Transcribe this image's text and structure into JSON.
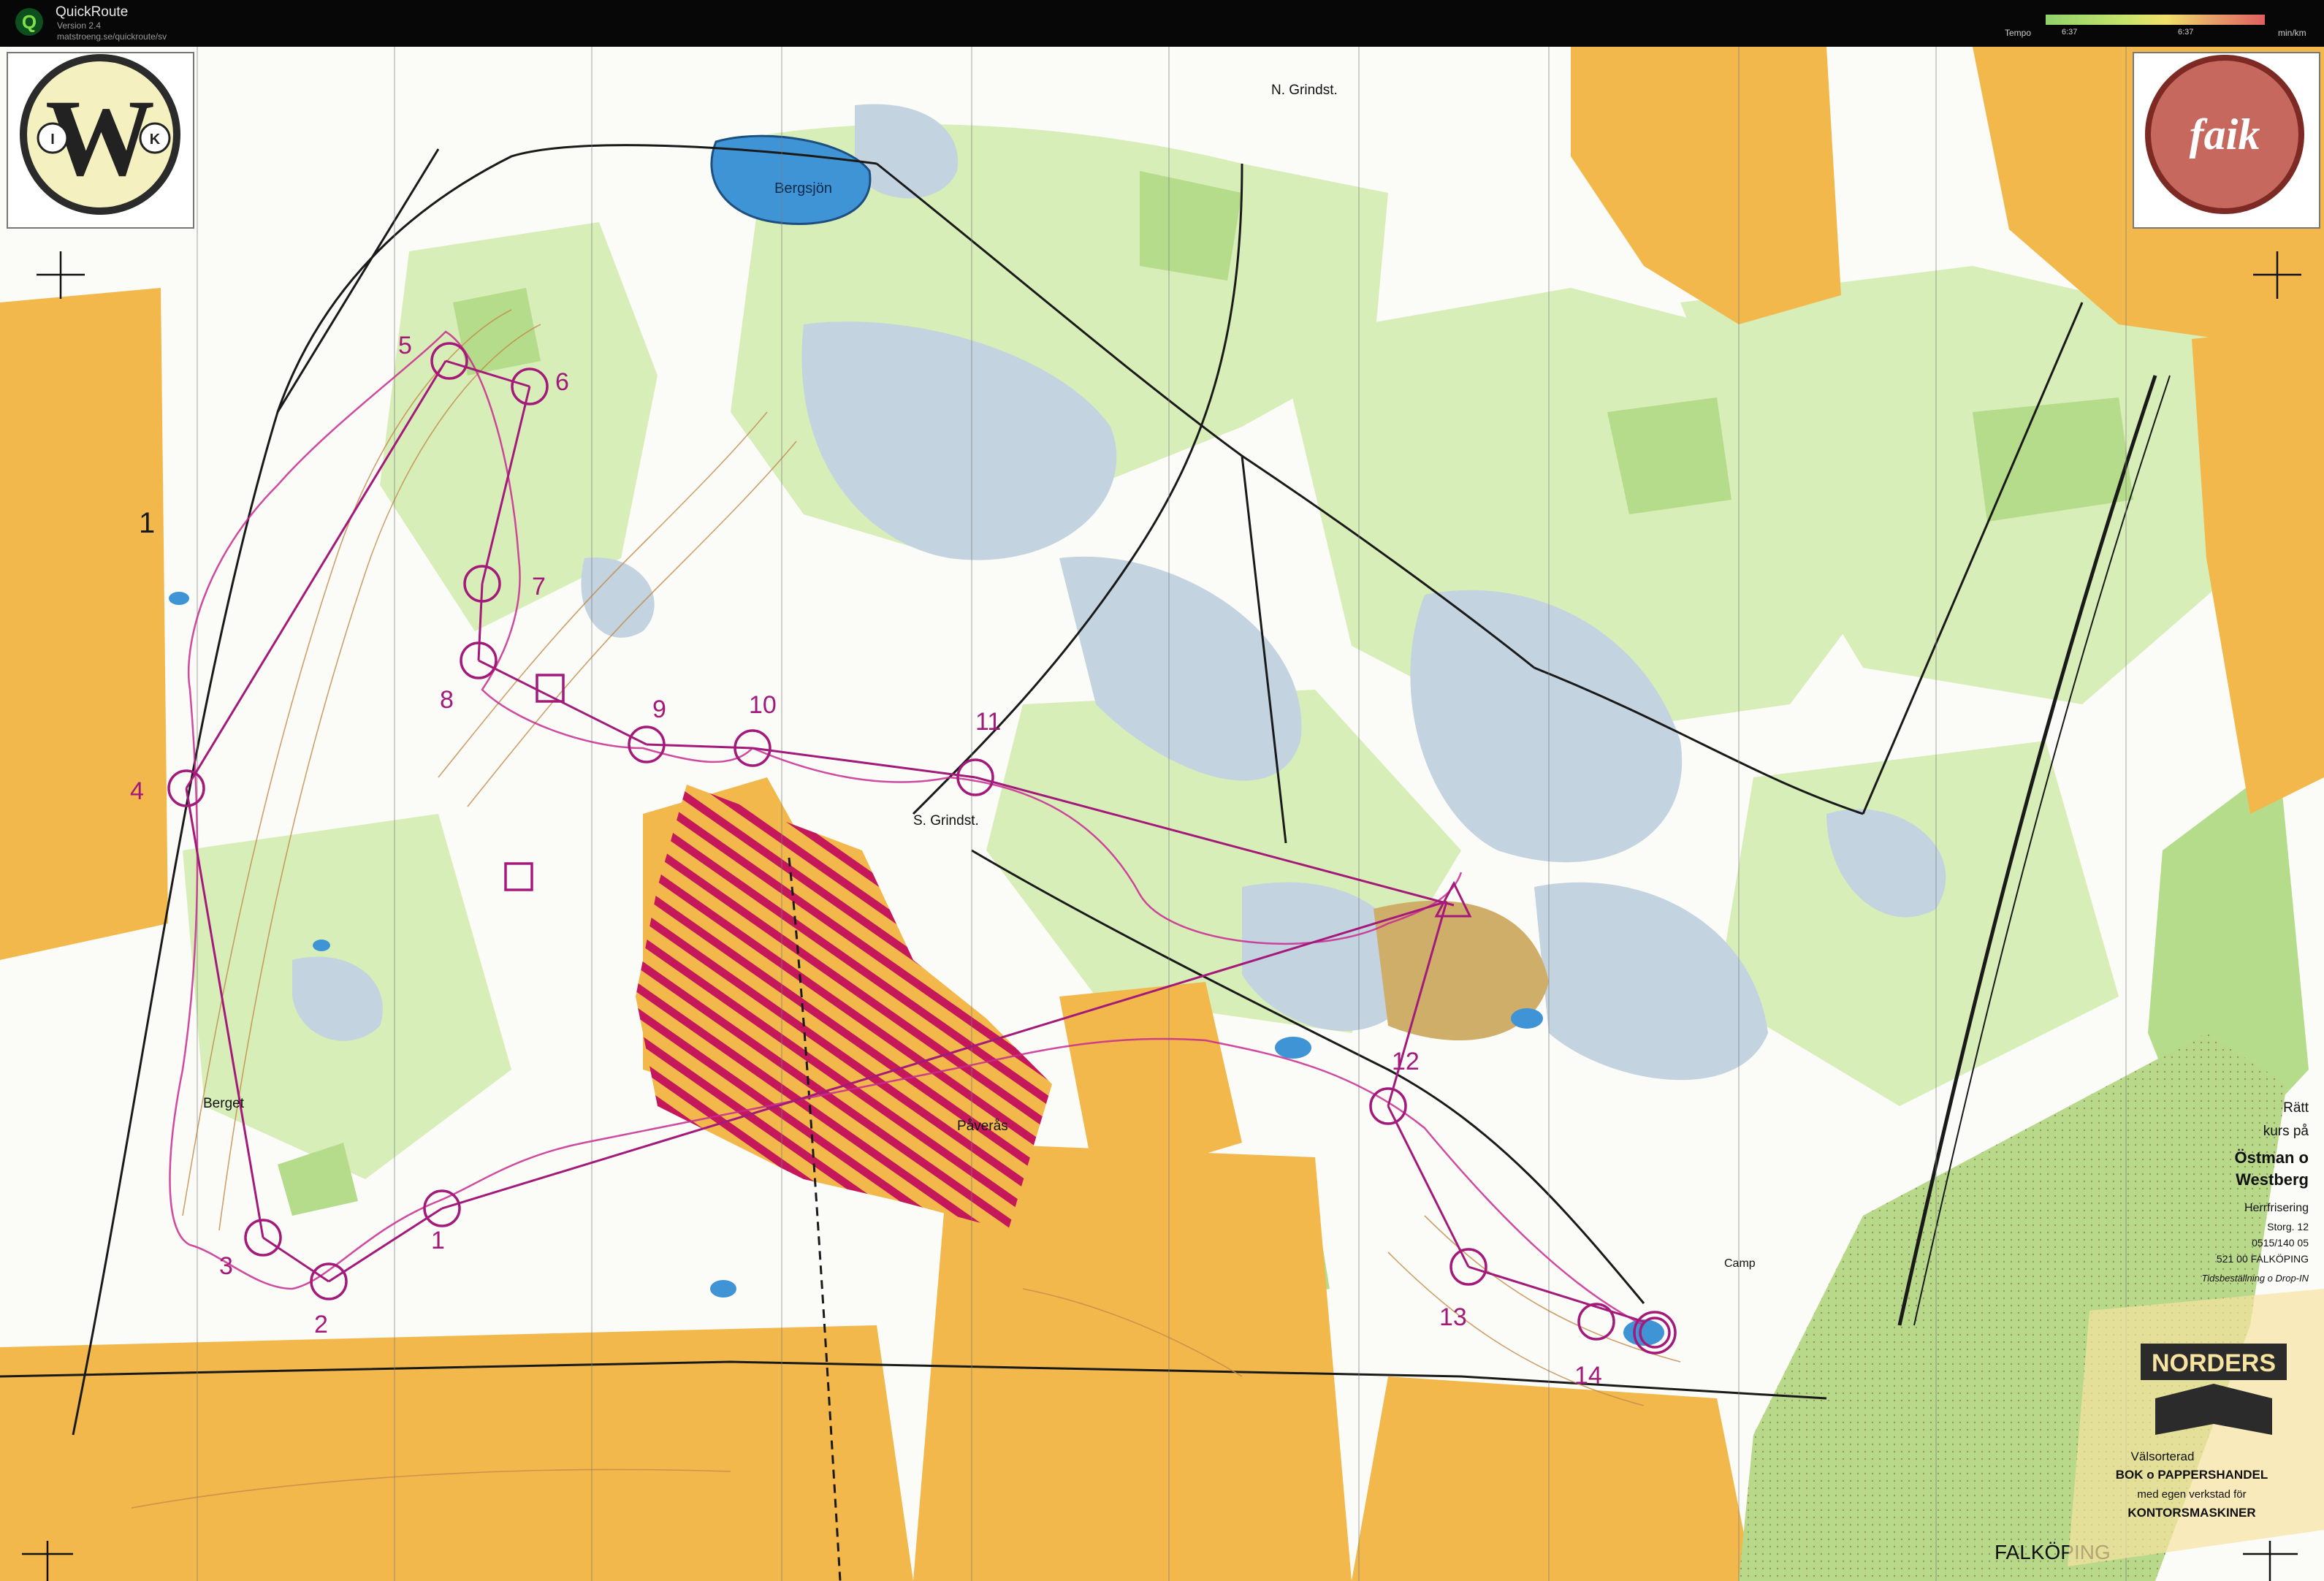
{
  "titlebar": {
    "app_name": "QuickRoute",
    "version": "Version 2.4",
    "url": "matstroeng.se/quickroute/sv",
    "tempo_label": "Tempo",
    "tempo_min": "6:37",
    "tempo_max": "6:37",
    "tempo_unit": "min/km"
  },
  "map": {
    "place_names": {
      "lake": "Bergsjön",
      "n_grindst": "N. Grindst.",
      "s_grindst": "S. Grindst.",
      "berget": "Berget",
      "paveras": "Påverås",
      "falkoping": "FALKÖPING",
      "camp": "Camp"
    },
    "control_numbers": [
      "1",
      "2",
      "3",
      "4",
      "5",
      "6",
      "7",
      "8",
      "9",
      "10",
      "11",
      "12",
      "13",
      "14"
    ],
    "logo_left": {
      "main": "W",
      "left": "I",
      "right": "K"
    },
    "logo_right": {
      "text": "faik"
    },
    "ad_box_1": {
      "line1": "Rätt",
      "line2": "kurs på",
      "line3": "Östman o",
      "line4": "Westberg",
      "line5": "Herrfrisering",
      "line6": "Storg. 12",
      "line7": "0515/140 05",
      "line8": "521 00 FALKÖPING",
      "line9": "Tidsbeställning o Drop-IN"
    },
    "ad_box_2": {
      "brand": "NORDERS",
      "line1": "Välsorterad",
      "line2": "BOK o PAPPERSHANDEL",
      "line3": "med egen verkstad för",
      "line4": "KONTORSMASKINER"
    },
    "colors": {
      "open_land": "#f2b84b",
      "forest_light": "#d8eeb8",
      "forest_green": "#b5dc8a",
      "marsh_blue": "#bfcfdc",
      "lake_blue": "#3f94d6",
      "course_purple": "#a31a7a",
      "contour_brown": "#c28a4a",
      "hatch_red": "#c4185b"
    }
  }
}
